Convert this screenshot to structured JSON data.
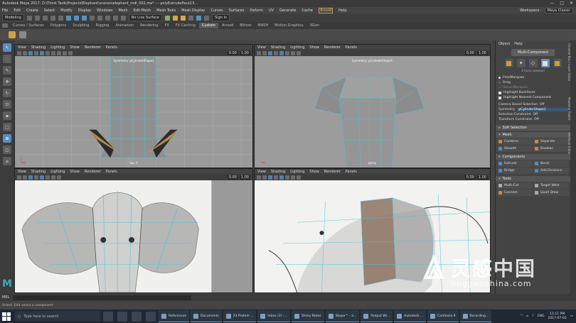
{
  "window": {
    "title": "Autodesk Maya 2017: D:\\Think Tank\\Projects\\Elephant\\scenes\\elephant_mdl_002.ma*  ---  polyExtrudeFace13...",
    "controls": [
      "—",
      "□",
      "✕"
    ]
  },
  "menubar": {
    "items": [
      "File",
      "Edit",
      "Create",
      "Select",
      "Modify",
      "Display",
      "Windows",
      "Mesh",
      "Edit Mesh",
      "Mesh Tools",
      "Mesh Display",
      "Curves",
      "Surfaces",
      "Deform",
      "UV",
      "Generate",
      "Cache",
      "Arnold",
      "Help"
    ],
    "highlighted": "Arnold",
    "workspace_label": "Workspace :",
    "workspace_value": "Maya Classic"
  },
  "statusline": {
    "mode": "Modeling",
    "live_surface": "No Live Surface",
    "sign_in": "Sign In"
  },
  "shelf": {
    "tabs": [
      "Curves / Surfaces",
      "Polygons",
      "Sculpting",
      "Rigging",
      "Animation",
      "Rendering",
      "FX",
      "FX Caching",
      "Custom",
      "Arnold",
      "Bifrost",
      "MASH",
      "Motion Graphics",
      "XGen"
    ],
    "active_tab": "Custom"
  },
  "viewport_menu": [
    "View",
    "Shading",
    "Lighting",
    "Show",
    "Renderer",
    "Panels"
  ],
  "viewport_fields": {
    "value_a": "0.00",
    "value_b": "1.00"
  },
  "viewports": {
    "top_left": {
      "symmetry": "Symmetry: pCylinderShape1",
      "camera": "top -Y"
    },
    "top_right": {
      "symmetry": "Symmetry: pCylinderShape1",
      "camera": "persp"
    }
  },
  "panel": {
    "tabs": [
      "Object",
      "Help"
    ],
    "multi_component": "Multi-Component",
    "selection_count": "4 faces selected",
    "options": [
      {
        "label": "Pick/Marquee",
        "kind": "radio",
        "on": true
      },
      {
        "label": "Drag",
        "kind": "radio",
        "on": false
      },
      {
        "label": "Tweak/Marquee",
        "kind": "radio",
        "on": false,
        "dim": true
      },
      {
        "label": "Highlight Backfaces",
        "kind": "check",
        "on": true
      },
      {
        "label": "Highlight Nearest Component",
        "kind": "check",
        "on": true
      }
    ],
    "camera_based_selection": {
      "label": "Camera Based Selection",
      "value": "Off"
    },
    "symmetry": {
      "label": "Symmetry",
      "value": "pCylinderShape1"
    },
    "selection_constraint": {
      "label": "Selection Constraint",
      "value": "Off"
    },
    "transform_constraint": {
      "label": "Transform Constraint",
      "value": "Off"
    },
    "soft_selection": "Soft Selection",
    "sections": [
      {
        "title": "Mesh",
        "buttons": [
          "Combine",
          "Separate",
          "Smooth",
          "Boolean"
        ]
      },
      {
        "title": "Components",
        "buttons": [
          "Extrude",
          "Bevel",
          "Bridge",
          "Add Divisions"
        ]
      },
      {
        "title": "Tools",
        "buttons": [
          "Multi-Cut",
          "Target Weld",
          "Connect",
          "Quad Draw"
        ]
      }
    ],
    "side_tabs": [
      "Channel Box / Layer Editor",
      "Modeling Toolkit",
      "Attribute Editor"
    ]
  },
  "timebar": {
    "mel_label": "MEL"
  },
  "helpline": {
    "text": "Select: Edit select a component"
  },
  "taskbar": {
    "search_placeholder": "Ask me anything",
    "search_text": "Type here to search",
    "tasks": [
      "References",
      "Documents",
      "23 Protein ...",
      "Inbox (2) -...",
      "Sticky Notes",
      "Skype™ - a...",
      "Output Wi...",
      "Autodesk ...",
      "Camtasia 9",
      "Recording..."
    ],
    "language": "ENG",
    "time": "11:11 PM",
    "date": "2017-07-02"
  },
  "watermark": {
    "name": "灵感中国",
    "url": "lingganchina.com"
  }
}
